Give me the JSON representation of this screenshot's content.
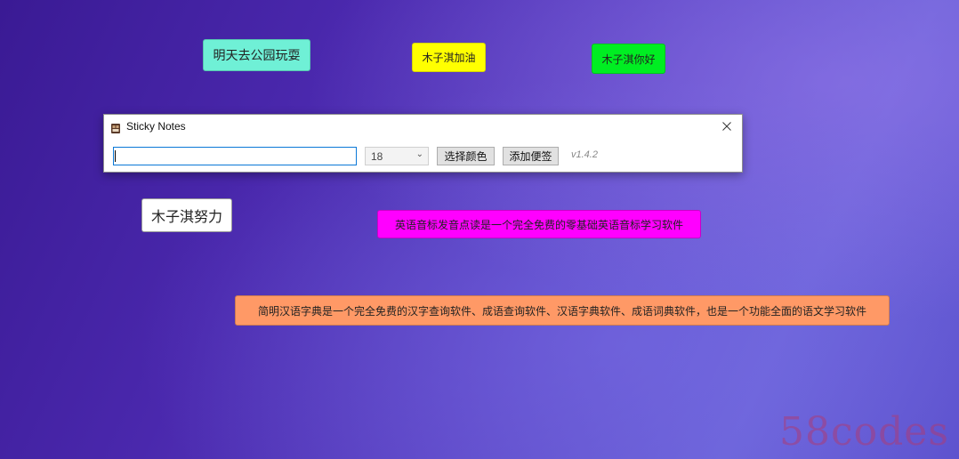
{
  "desktop_notes": [
    {
      "text": "明天去公园玩耍",
      "color": "#6ff0d6"
    },
    {
      "text": "木子淇加油",
      "color": "#ffff00"
    },
    {
      "text": "木子淇你好",
      "color": "#00ee22"
    },
    {
      "text": "木子淇努力",
      "color": "#ffffff"
    },
    {
      "text": "英语音标发音点读是一个完全免费的零基础英语音标学习软件",
      "color": "#ff00ff"
    },
    {
      "text": "简明汉语字典是一个完全免费的汉字查询软件、成语查询软件、汉语字典软件、成语词典软件，也是一个功能全面的语文学习软件",
      "color": "#ff9966"
    }
  ],
  "window": {
    "title": "Sticky Notes",
    "close_icon": "close-icon",
    "app_icon": "app-icon"
  },
  "toolbar": {
    "note_input_value": "",
    "font_size_value": "18",
    "choose_color_label": "选择颜色",
    "add_note_label": "添加便签",
    "version": "v1.4.2"
  },
  "watermark": "58codes"
}
